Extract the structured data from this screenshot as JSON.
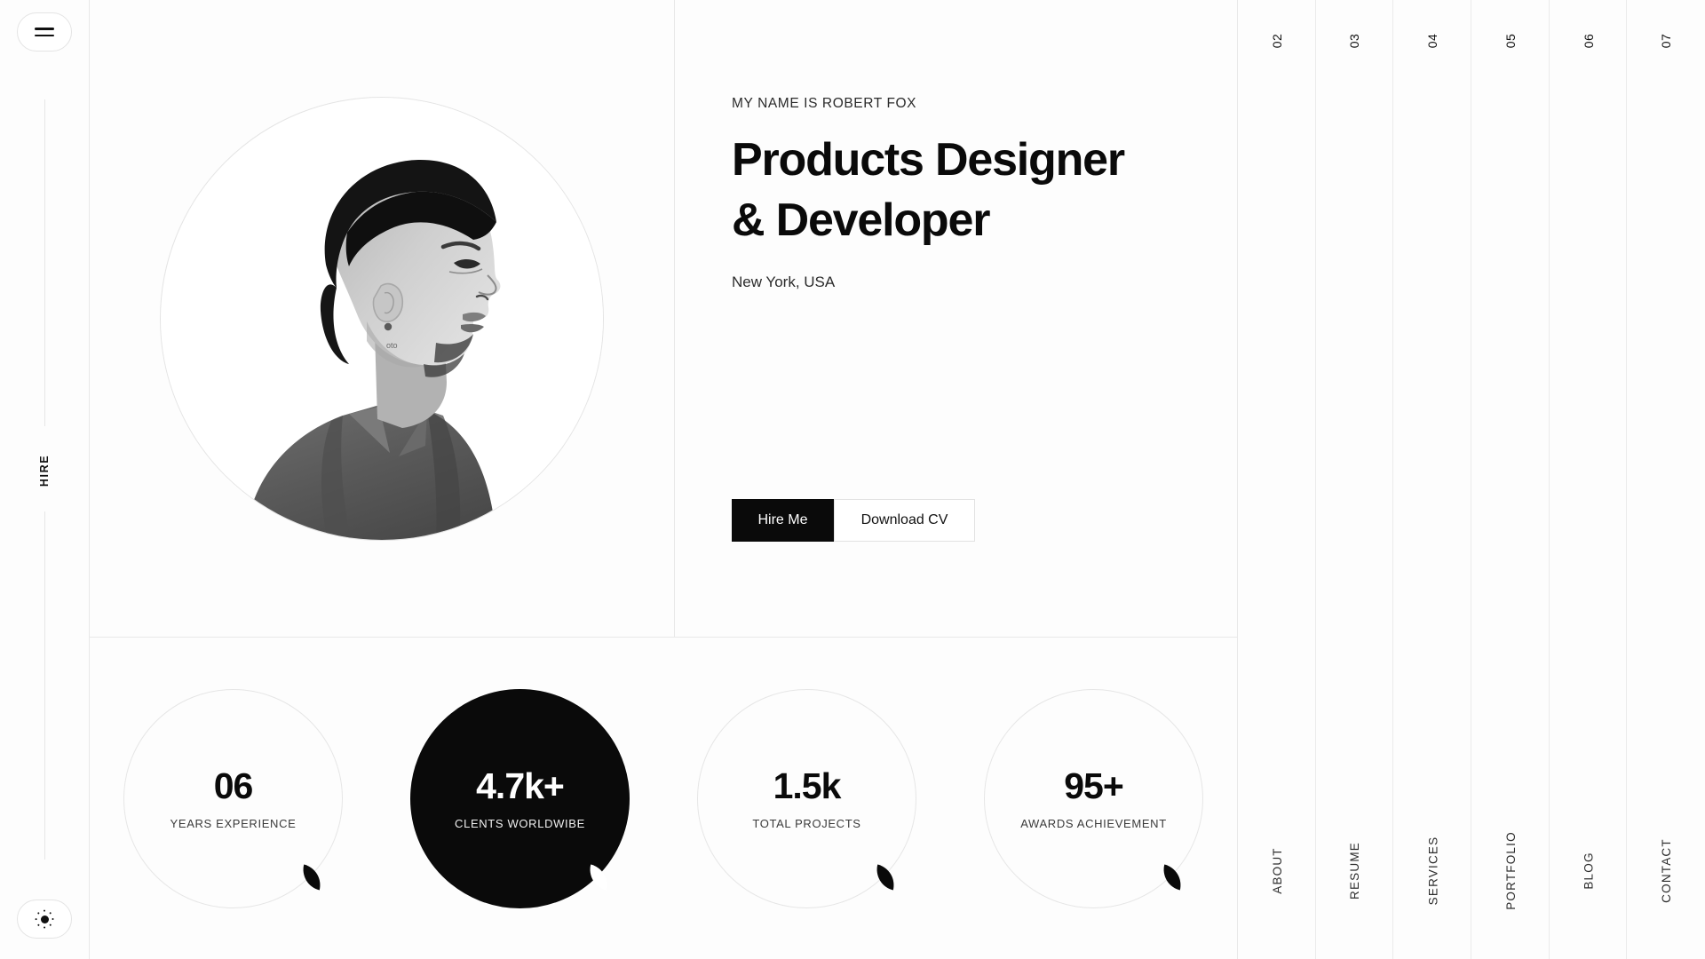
{
  "theme": {
    "background": "#fdfdfd",
    "accent": "#0a0a0a",
    "border": "#e8e8e8",
    "text": "#111111"
  },
  "left_rail": {
    "menu_icon": "hamburger-menu-icon",
    "theme_icon": "sun-icon",
    "hire_label": "HIRE"
  },
  "hero": {
    "portrait_alt": "portrait-photo",
    "eyebrow": "MY NAME IS ROBERT FOX",
    "headline_line1": "Products Designer",
    "headline_line2": "& Developer",
    "location": "New York, USA",
    "primary_button": "Hire Me",
    "secondary_button": "Download CV"
  },
  "stats": [
    {
      "value": "06",
      "label": "YEARS EXPERIENCE",
      "filled": false
    },
    {
      "value": "4.7k+",
      "label": "CLENTS WORLDWIBE",
      "filled": true
    },
    {
      "value": "1.5k",
      "label": "TOTAL PROJECTS",
      "filled": false
    },
    {
      "value": "95+",
      "label": "AWARDS ACHIEVEMENT",
      "filled": false
    }
  ],
  "right_nav": [
    {
      "number": "02",
      "label": "ABOUT"
    },
    {
      "number": "03",
      "label": "RESUME"
    },
    {
      "number": "04",
      "label": "SERVICES"
    },
    {
      "number": "05",
      "label": "PORTFOLIO"
    },
    {
      "number": "06",
      "label": "BLOG"
    },
    {
      "number": "07",
      "label": "CONTACT"
    }
  ]
}
